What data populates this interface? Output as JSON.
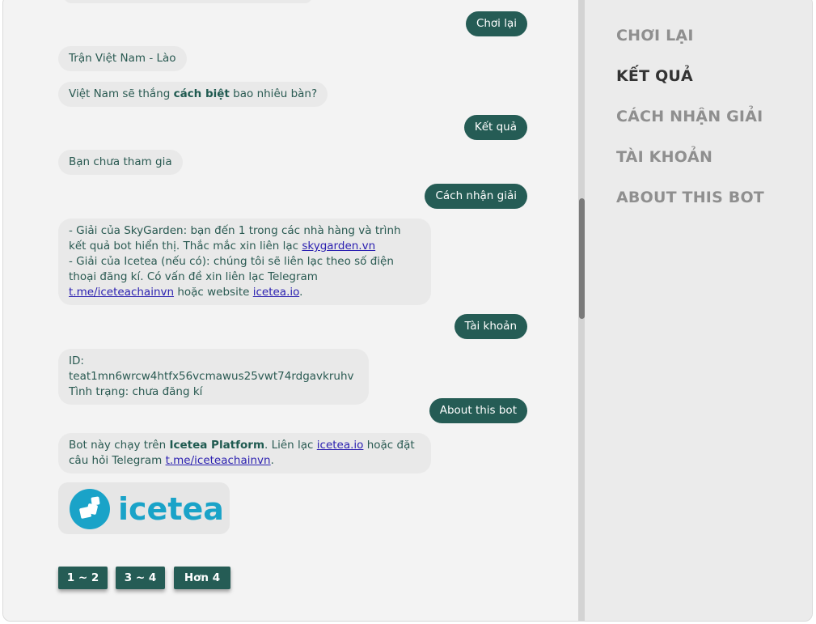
{
  "chat": {
    "messages": [
      {
        "from": "user",
        "text": "Chơi lại"
      },
      {
        "from": "bot",
        "text": "Trận Việt Nam - Lào"
      },
      {
        "from": "bot",
        "pre": "Việt Nam sẽ thắng ",
        "bold": "cách biệt",
        "post": " bao nhiêu bàn?"
      },
      {
        "from": "user",
        "text": "Kết quả"
      },
      {
        "from": "bot",
        "text": "Bạn chưa tham gia"
      },
      {
        "from": "user",
        "text": "Cách nhận giải"
      },
      {
        "from": "bot",
        "line1": "- Giải của SkyGarden: bạn đến 1 trong các nhà hàng và trình kết quả bot hiển thị. Thắc mắc xin liên lạc ",
        "link1": "skygarden.vn",
        "line2": "- Giải của Icetea (nếu có): chúng tôi sẽ liên lạc theo số điện thoại đăng kí. Có vấn đề xin liên lạc Telegram ",
        "link2": "t.me/iceteachainvn",
        "line2b": " hoặc website ",
        "link3": "icetea.io",
        "end": "."
      },
      {
        "from": "user",
        "text": "Tài khoản"
      },
      {
        "from": "bot",
        "id_line": "ID: teat1mn6wrcw4htfx56vcmawus25vwt74rdgavkruhv",
        "status_line": "Tình trạng: chưa đăng kí"
      },
      {
        "from": "user",
        "text": "About this bot"
      },
      {
        "from": "bot",
        "pre": "Bot này chạy trên ",
        "bold": "Icetea Platform",
        "mid": ". Liên lạc ",
        "link1": "icetea.io",
        "mid2": " hoặc đặt câu hỏi Telegram ",
        "link2": "t.me/iceteachainvn",
        "end": "."
      }
    ],
    "logo": {
      "wordmark": "icetea",
      "icon": "icetea-logo-icon",
      "color": "#1aa3c8"
    },
    "quick_replies": [
      "1 ~ 2",
      "3 ~ 4",
      "Hơn 4"
    ]
  },
  "sidebar": {
    "items": [
      {
        "label": "CHƠI LẠI",
        "active": false
      },
      {
        "label": "KẾT QUẢ",
        "active": true
      },
      {
        "label": "CÁCH NHẬN GIẢI",
        "active": false
      },
      {
        "label": "TÀI KHOẢN",
        "active": false
      },
      {
        "label": "ABOUT THIS BOT",
        "active": false
      }
    ]
  },
  "colors": {
    "accent": "#255c55",
    "bot_bubble": "#e9e9e9",
    "link": "#2a1fb0",
    "sidebar_bg": "#ebebeb",
    "menu_inactive": "#8f8f8f",
    "menu_active": "#333333"
  }
}
